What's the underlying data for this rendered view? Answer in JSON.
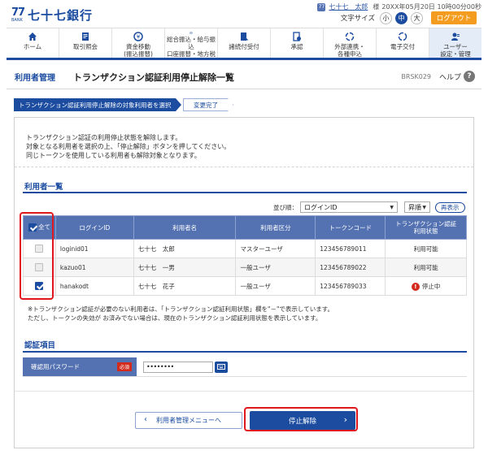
{
  "header": {
    "logo_num": "77",
    "logo_bank": "BANK",
    "logo_text": "七十七銀行",
    "user_icon": "77",
    "user_name": "七十七　太郎",
    "user_suffix": "様",
    "datetime": "20XX年05月20日 10時00分00秒",
    "font_size_label": "文字サイズ",
    "font_sizes": [
      "小",
      "中",
      "大"
    ],
    "logout": "ログアウト"
  },
  "nav": [
    {
      "label": "ホーム",
      "icon": "home-icon"
    },
    {
      "label": "取引照会",
      "icon": "inquiry-icon"
    },
    {
      "label": "資金移動\n(振込振替)",
      "icon": "transfer-icon"
    },
    {
      "label": "総合振込・給与振込\n口座振替・地方税",
      "icon": "bulk-transfer-icon"
    },
    {
      "label": "諸続付受付",
      "icon": "procedure-icon"
    },
    {
      "label": "承認",
      "icon": "approval-icon"
    },
    {
      "label": "外部連携・\n各種申込",
      "icon": "external-link-icon"
    },
    {
      "label": "電子交付",
      "icon": "e-delivery-icon"
    },
    {
      "label": "ユーザー\n設定・管理",
      "icon": "user-settings-icon"
    }
  ],
  "title": {
    "section": "利用者管理",
    "main": "トランザクション認証利用停止解除一覧",
    "code": "BRSK029",
    "help": "ヘルプ",
    "help_icon": "?"
  },
  "steps": {
    "current": "トランザクション認証利用停止解除の対象利用者を選択",
    "next": "変更完了"
  },
  "description": [
    "トランザクション認証の利用停止状態を解除します。",
    "対象となる利用者を選択の上、「停止解除」ボタンを押してください。",
    "同じトークンを使用している利用者も解除対象となります。"
  ],
  "user_list": {
    "title": "利用者一覧",
    "sort_label": "並び順：",
    "sort_value": "ログインID",
    "order_value": "昇順",
    "redisplay": "再表示",
    "headers": {
      "select_all": "全て",
      "login_id": "ログインID",
      "user_name": "利用者名",
      "user_type": "利用者区分",
      "token_code": "トークンコード",
      "status": "トランザクション認証\n利用状態"
    },
    "rows": [
      {
        "login_id": "loginid01",
        "user_name": "七十七　太郎",
        "user_type": "マスターユーザ",
        "token_code": "123456789011",
        "status": "利用可能",
        "checked": false,
        "stopped": false
      },
      {
        "login_id": "kazuo01",
        "user_name": "七十七　一男",
        "user_type": "一般ユーザ",
        "token_code": "123456789022",
        "status": "利用可能",
        "checked": false,
        "stopped": false
      },
      {
        "login_id": "hanakodt",
        "user_name": "七十七　花子",
        "user_type": "一般ユーザ",
        "token_code": "123456789033",
        "status": "停止中",
        "checked": true,
        "stopped": true
      }
    ],
    "stop_icon": "!"
  },
  "notes": [
    "※トランザクション認証が必要のない利用者は、「トランザクション認証利用状態」欄を\"－\"で表示しています。",
    "ただし、トークンの失効が お済みでない場合は、現在のトランザクション認証利用状態を表示しています。"
  ],
  "auth": {
    "title": "認証項目",
    "pw_label": "確認用パスワード",
    "required": "必須",
    "pw_value": "••••••••"
  },
  "buttons": {
    "back": "利用者管理メニューへ",
    "back_chevron": "‹",
    "submit": "停止解除",
    "submit_chevron": "›"
  },
  "colors": {
    "brand": "#1b4ca0",
    "table_header": "#5472b2",
    "logout": "#f39c1f",
    "highlight": "#e0181e",
    "stopped": "#d32a1e"
  }
}
